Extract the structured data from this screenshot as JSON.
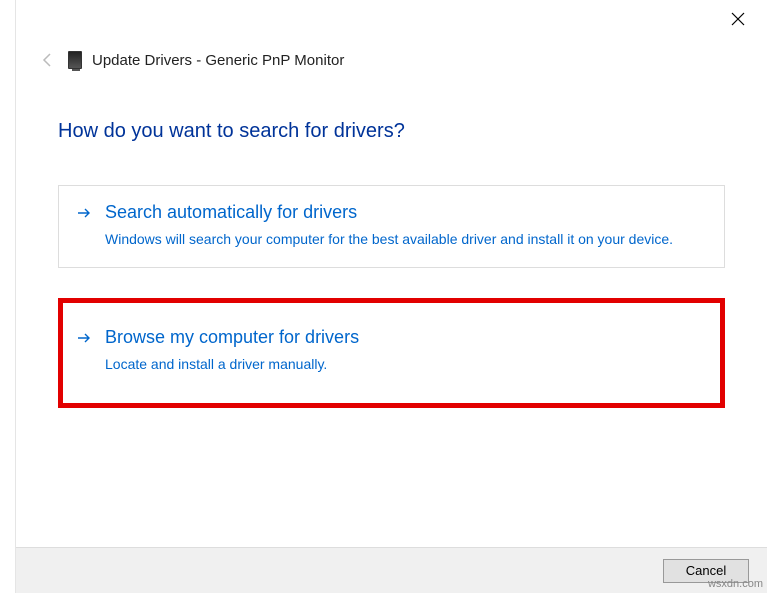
{
  "header": {
    "title": "Update Drivers - Generic PnP Monitor"
  },
  "question": "How do you want to search for drivers?",
  "options": [
    {
      "title": "Search automatically for drivers",
      "desc": "Windows will search your computer for the best available driver and install it on your device."
    },
    {
      "title": "Browse my computer for drivers",
      "desc": "Locate and install a driver manually."
    }
  ],
  "footer": {
    "cancel": "Cancel"
  },
  "watermark": "wsxdn.com"
}
